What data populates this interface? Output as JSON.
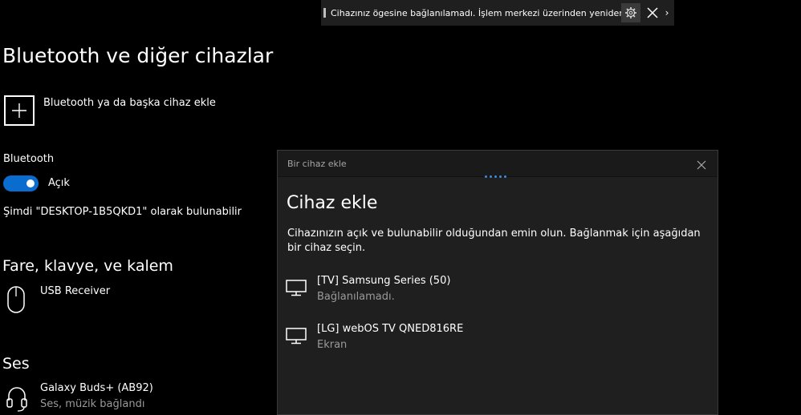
{
  "toast": {
    "message": "Cihazınız ögesine bağlanılamadı. İşlem merkezi üzerinden yeniden bağlanın",
    "chevron": "›"
  },
  "page": {
    "title": "Bluetooth ve diğer cihazlar",
    "add_device_label": "Bluetooth ya da başka cihaz ekle",
    "bluetooth": {
      "label": "Bluetooth",
      "toggle_state": "Açık",
      "discoverable_text": "Şimdi \"DESKTOP-1B5QKD1\" olarak bulunabilir"
    },
    "sections": {
      "input": {
        "title": "Fare, klavye, ve kalem",
        "devices": [
          {
            "name": "USB Receiver",
            "icon": "mouse-icon"
          }
        ]
      },
      "audio": {
        "title": "Ses",
        "devices": [
          {
            "name": "Galaxy Buds+ (AB92)",
            "status": "Ses, müzik bağlandı",
            "icon": "headset-icon"
          }
        ]
      }
    }
  },
  "dialog": {
    "caption": "Bir cihaz ekle",
    "title": "Cihaz ekle",
    "description": "Cihazınızın açık ve bulunabilir olduğundan emin olun. Bağlanmak için aşağıdan bir cihaz seçin.",
    "devices": [
      {
        "name": "[TV] Samsung   Series (50)",
        "status": "Bağlanılamadı.",
        "icon": "monitor-icon"
      },
      {
        "name": "[LG] webOS TV QNED816RE",
        "status": "Ekran",
        "icon": "monitor-icon"
      }
    ]
  },
  "colors": {
    "accent": "#0b6ccf",
    "progress_dots": "#3c8dde",
    "dialog_bg": "#1f1f1f"
  }
}
